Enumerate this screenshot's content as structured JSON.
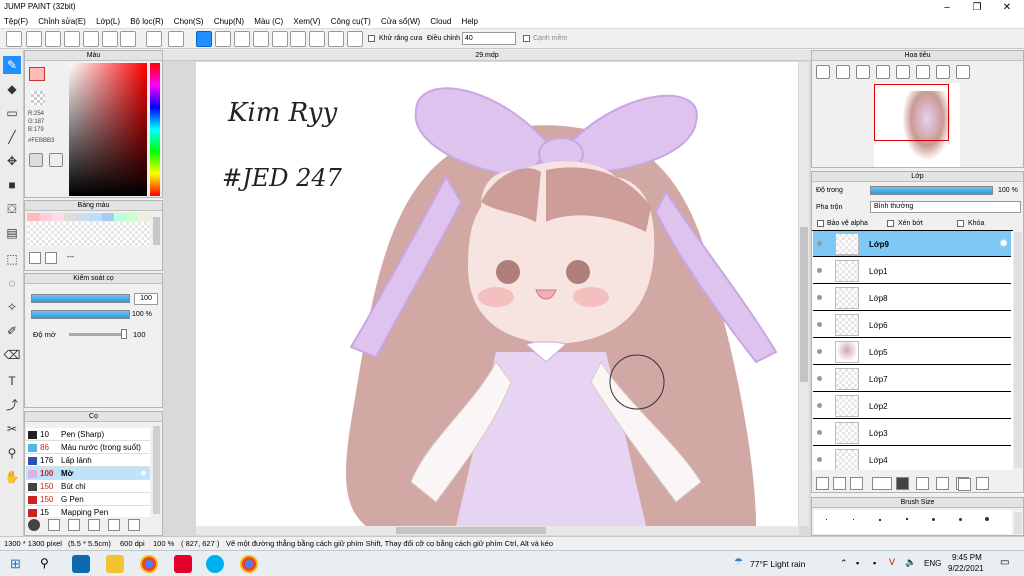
{
  "app": {
    "title": "JUMP PAINT (32bit)"
  },
  "menu": [
    "Tệp(F)",
    "Chỉnh sửa(E)",
    "Lớp(L)",
    "Bộ lọc(R)",
    "Chọn(S)",
    "Chụp(N)",
    "Màu (C)",
    "Xem(V)",
    "Công cụ(T)",
    "Cửa sổ(W)",
    "Cloud",
    "Help"
  ],
  "toolbar": {
    "antialias_label": "Khử răng cưa",
    "adjust_label": "Điều chỉnh",
    "adjust_value": "40",
    "snap_label": "Cạnh mềm"
  },
  "canvas": {
    "tab": "29.mdp"
  },
  "color_panel": {
    "title": "Màu",
    "r": "R:254",
    "g": "G:187",
    "b": "B:179",
    "hex": "#FEBBB3",
    "main_color": "#FEBBB3"
  },
  "palette_panel": {
    "title": "Bảng màu",
    "value": "---"
  },
  "brush_ctrl": {
    "title": "Kiểm soát cọ",
    "size_value": "100",
    "opacity_value": "100 %",
    "blur_label": "Độ mờ",
    "blur_value": "100"
  },
  "brush_panel": {
    "title": "Cọ",
    "brushes": [
      {
        "size": "10",
        "name": "Pen (Sharp)",
        "color": "#222222",
        "size_color": "#000000"
      },
      {
        "size": "86",
        "name": "Màu nước (trong suốt)",
        "color": "#4fb8e8",
        "size_color": "#cc2222"
      },
      {
        "size": "176",
        "name": "Lấp lánh",
        "color": "#2a4fb5",
        "size_color": "#000000"
      },
      {
        "size": "100",
        "name": "Mờ",
        "color": "#d9b3e8",
        "size_color": "#cc2222"
      },
      {
        "size": "150",
        "name": "Bút chì",
        "color": "#444444",
        "size_color": "#cc2222"
      },
      {
        "size": "150",
        "name": "G Pen",
        "color": "#cc2222",
        "size_color": "#cc2222"
      },
      {
        "size": "15",
        "name": "Mapping Pen",
        "color": "#cc2222",
        "size_color": "#000000"
      }
    ]
  },
  "navigator": {
    "title": "Hoa tiêu"
  },
  "layer_panel": {
    "title": "Lớp",
    "opacity_label": "Độ trong",
    "opacity_value": "100 %",
    "blend_label": "Pha trộn",
    "blend_value": "Bình thường",
    "protect_alpha": "Bảo vệ alpha",
    "clip": "Xén bớt",
    "lock": "Khóa",
    "layers": [
      "Lớp9",
      "Lớp1",
      "Lớp8",
      "Lớp6",
      "Lớp5",
      "Lớp7",
      "Lớp2",
      "Lớp3",
      "Lớp4"
    ]
  },
  "brush_size_panel": {
    "title": "Brush Size"
  },
  "handwriting": {
    "line1": "Kim Ryy",
    "line2": "#JED 247"
  },
  "status": {
    "size": "1300 * 1300 pixel",
    "cm": "(5.5 * 5.5cm)",
    "dpi": "600 dpi",
    "zoom": "100 %",
    "coords": "( 827, 627 )",
    "hint": "Vẽ một đường thẳng bằng cách giữ phím Shift, Thay đổi cỡ cọ bằng cách giữ phím Ctrl, Alt và kéo"
  },
  "taskbar": {
    "weather": "77°F  Light rain",
    "lang": "ENG",
    "time": "9:45 PM",
    "date": "9/22/2021"
  }
}
